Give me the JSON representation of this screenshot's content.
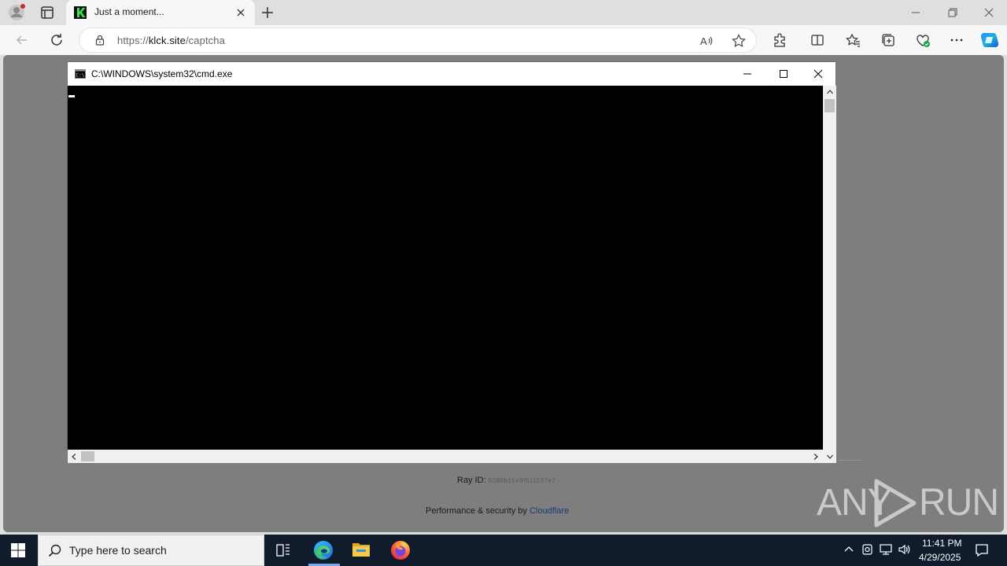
{
  "browser": {
    "tab_title": "Just a moment...",
    "url_prefix": "https://",
    "url_domain": "klck.site",
    "url_path": "/captcha"
  },
  "page": {
    "ray_label": "Ray ID:",
    "ray_value": "9388b15e9f911137e7",
    "perf_prefix": "Performance & security by ",
    "perf_link": "Cloudflare",
    "watermark_left": "ANY",
    "watermark_right": "RUN"
  },
  "cmd": {
    "title": "C:\\WINDOWS\\system32\\cmd.exe"
  },
  "taskbar": {
    "search_placeholder": "Type here to search",
    "time": "11:41 PM",
    "date": "4/29/2025"
  },
  "colors": {
    "accent_blue": "#0c59a4",
    "console_bg": "#000000",
    "taskbar_bg": "#101b2b"
  }
}
